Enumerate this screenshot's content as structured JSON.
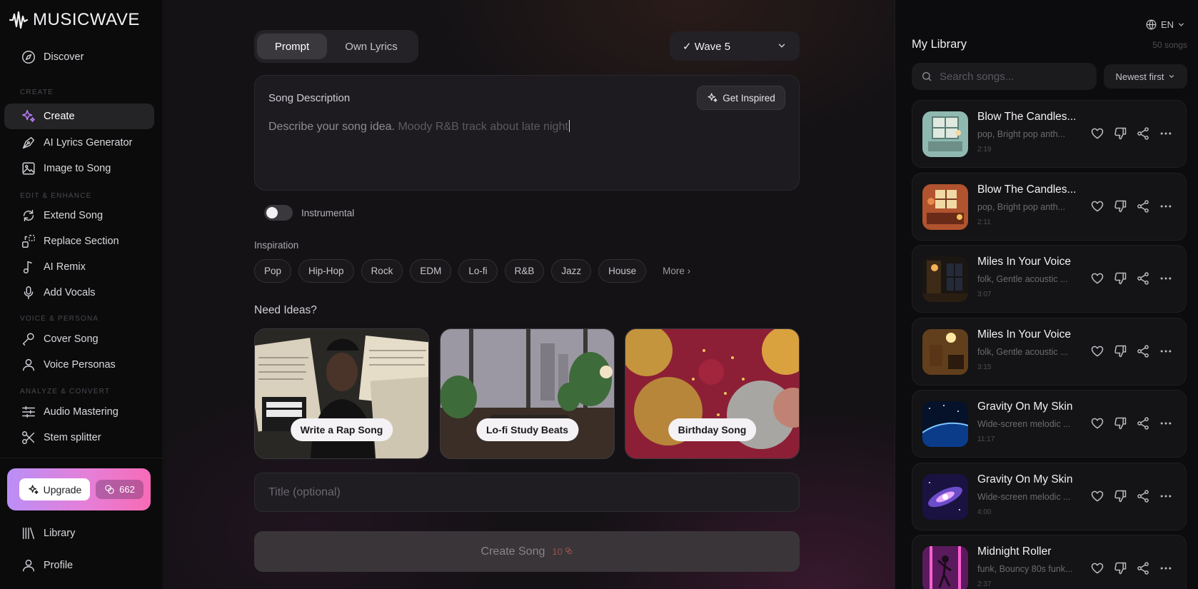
{
  "app": {
    "name": "MUSICWAVE"
  },
  "sidebar": {
    "discover": "Discover",
    "sections": {
      "create": "CREATE",
      "edit": "EDIT & ENHANCE",
      "voice": "VOICE & PERSONA",
      "analyze": "ANALYZE & CONVERT"
    },
    "items": {
      "create": "Create",
      "lyrics": "AI Lyrics Generator",
      "image_to_song": "Image to Song",
      "extend": "Extend Song",
      "replace": "Replace Section",
      "remix": "AI Remix",
      "vocals": "Add Vocals",
      "cover": "Cover Song",
      "personas": "Voice Personas",
      "mastering": "Audio Mastering",
      "stem": "Stem splitter",
      "library": "Library",
      "profile": "Profile"
    },
    "upgrade_label": "Upgrade",
    "credits": "662",
    "accent_gradient": [
      "#b98ff7",
      "#e57fd8",
      "#f76bb5"
    ]
  },
  "main": {
    "mode_tabs": [
      "Prompt",
      "Own Lyrics"
    ],
    "active_mode": "Prompt",
    "model": "✓ Wave 5",
    "description": {
      "label": "Song Description",
      "get_inspired": "Get Inspired",
      "static_text": "Describe your song idea.",
      "typed_text": "Moody R&B track about late night"
    },
    "instrumental_label": "Instrumental",
    "instrumental_on": false,
    "inspiration_label": "Inspiration",
    "genres": [
      "Pop",
      "Hip-Hop",
      "Rock",
      "EDM",
      "Lo-fi",
      "R&B",
      "Jazz",
      "House"
    ],
    "more_label": "More ›",
    "ideas_label": "Need Ideas?",
    "ideas": [
      "Write a Rap Song",
      "Lo-fi Study Beats",
      "Birthday Song"
    ],
    "title_placeholder": "Title (optional)",
    "create_label": "Create Song",
    "create_cost": "10"
  },
  "library": {
    "language": "EN",
    "title": "My Library",
    "count": "50 songs",
    "search_placeholder": "Search songs...",
    "sort": "Newest first",
    "songs": [
      {
        "title": "Blow The Candles...",
        "desc": "pop, Bright pop anth...",
        "duration": "2:19",
        "art": "room-teal"
      },
      {
        "title": "Blow The Candles...",
        "desc": "pop, Bright pop anth...",
        "duration": "2:11",
        "art": "room-warm"
      },
      {
        "title": "Miles In Your Voice",
        "desc": "folk, Gentle acoustic ...",
        "duration": "3:07",
        "art": "window-night"
      },
      {
        "title": "Miles In Your Voice",
        "desc": "folk, Gentle acoustic ...",
        "duration": "3:15",
        "art": "lamp-room"
      },
      {
        "title": "Gravity On My Skin",
        "desc": "Wide-screen melodic ...",
        "duration": "11:17",
        "art": "planet-horizon"
      },
      {
        "title": "Gravity On My Skin",
        "desc": "Wide-screen melodic ...",
        "duration": "4:00",
        "art": "galaxy"
      },
      {
        "title": "Midnight Roller",
        "desc": "funk, Bouncy 80s funk...",
        "duration": "2:37",
        "art": "neon-dancer"
      }
    ]
  }
}
